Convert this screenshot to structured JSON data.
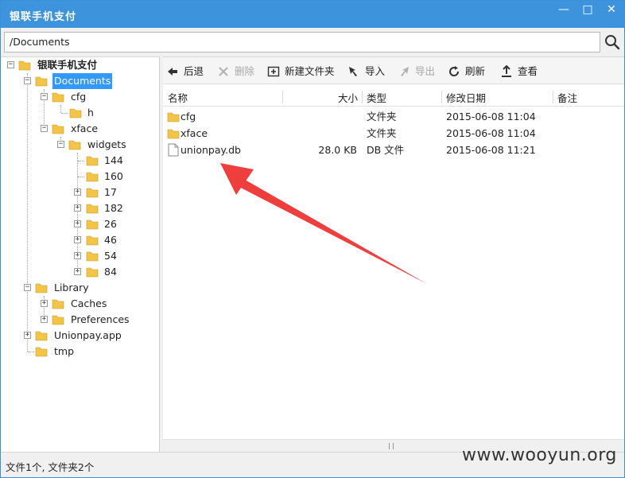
{
  "window": {
    "title": "银联手机支付",
    "minimize_glyph": "—",
    "maximize_glyph": "□",
    "close_glyph": "✕"
  },
  "address": {
    "path": "/Documents"
  },
  "tree": {
    "root": "银联手机支付",
    "documents": "Documents",
    "cfg": "cfg",
    "h": "h",
    "xface": "xface",
    "widgets": "widgets",
    "w144": "144",
    "w160": "160",
    "w17": "17",
    "w182": "182",
    "w26": "26",
    "w46": "46",
    "w54": "54",
    "w84": "84",
    "library": "Library",
    "caches": "Caches",
    "preferences": "Preferences",
    "unionpay_app": "Unionpay.app",
    "tmp": "tmp"
  },
  "toolbar": {
    "back": "后退",
    "delete": "删除",
    "new_folder": "新建文件夹",
    "import": "导入",
    "export": "导出",
    "refresh": "刷新",
    "view": "查看"
  },
  "columns": {
    "name": "名称",
    "size": "大小",
    "type": "类型",
    "modified": "修改日期",
    "note": "备注"
  },
  "files": [
    {
      "name": "cfg",
      "size": "",
      "type": "文件夹",
      "modified": "2015-06-08 11:04",
      "note": ""
    },
    {
      "name": "xface",
      "size": "",
      "type": "文件夹",
      "modified": "2015-06-08 11:04",
      "note": ""
    },
    {
      "name": "unionpay.db",
      "size": "28.0 KB",
      "type": "DB 文件",
      "modified": "2015-06-08 11:21",
      "note": ""
    }
  ],
  "status": {
    "text": "文件1个, 文件夹2个"
  },
  "watermark": "www.wooyun.org",
  "colors": {
    "titlebar": "#3d94dc",
    "selection": "#3399ff",
    "folder": "#f2c447",
    "annotation_arrow": "#ee3e3e"
  }
}
